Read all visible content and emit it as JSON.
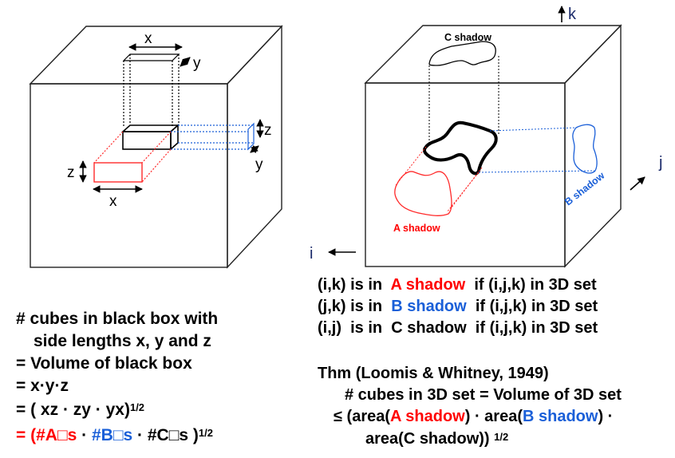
{
  "left_figure": {
    "label_x_top": "x",
    "label_y_top": "y",
    "label_z_right": "z",
    "label_y_right": "y",
    "label_z_left": "z",
    "label_x_bottom": "x"
  },
  "right_figure": {
    "axis_k": "k",
    "axis_j": "j",
    "axis_i": "i",
    "c_shadow": "C shadow",
    "a_shadow": "A shadow",
    "b_shadow": "B shadow"
  },
  "left_text": {
    "line1": "# cubes in black box with",
    "line2": "side lengths x, y and z",
    "line3": "= Volume of black box",
    "line4": "= x·y·z",
    "line5_pre": "= ( xz · zy · yx)",
    "line5_sup": "1/2",
    "line6_pre": "= (",
    "line6_a": "#A□s",
    "line6_dot1": " · ",
    "line6_b": "#B□s",
    "line6_mid": " · #C□s )",
    "line6_sup": "1/2"
  },
  "right_text": {
    "r1_pre": "(i,k) is in ",
    "r1_shadow": "A shadow",
    "r1_post": "  if (i,j,k) in 3D set",
    "r2_pre": "(j,k) is in ",
    "r2_shadow": "B shadow",
    "r2_post": "  if (i,j,k) in 3D set",
    "r3": "(i,j)  is in  C shadow  if (i,j,k) in 3D set",
    "thm": "Thm (Loomis & Whitney, 1949)",
    "thm2": "# cubes in 3D set = Volume of 3D set",
    "thm3_pre": "≤ (area(",
    "thm3_a": "A shadow",
    "thm3_mid": ") · area(",
    "thm3_b": "B shadow",
    "thm3_post": ") ·",
    "thm4_pre": "area(C shadow))",
    "thm4_sup": "1/2"
  }
}
